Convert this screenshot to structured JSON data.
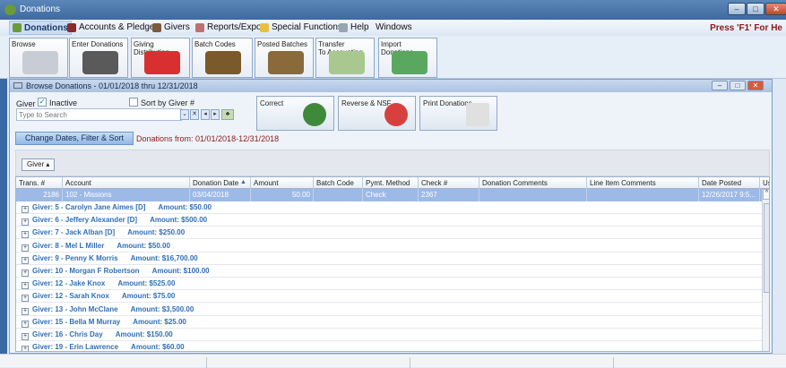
{
  "window": {
    "title": "Donations",
    "help_hint": "Press 'F1' For He"
  },
  "menu": [
    {
      "label": "Donations",
      "color": "#6a9a3a"
    },
    {
      "label": "Accounts & Pledges",
      "color": "#8b2a2a"
    },
    {
      "label": "Givers",
      "color": "#7a5a3a"
    },
    {
      "label": "Reports/Export",
      "color": "#c07070"
    },
    {
      "label": "Special Functions",
      "color": "#e8c040"
    },
    {
      "label": "Help",
      "color": "#9aa4b0"
    },
    {
      "label": "Windows",
      "color": ""
    }
  ],
  "toolbar": [
    {
      "label": "Browse",
      "color": "#c8ccd4"
    },
    {
      "label": "Enter Donations",
      "color": "#5a5a5a"
    },
    {
      "label": "Giving Distribution",
      "color": "#d83030"
    },
    {
      "label": "Batch Codes",
      "color": "#7a5a2a"
    },
    {
      "label": "Posted Batches",
      "color": "#8a6a3a"
    },
    {
      "label": "Transfer\nTo Accounting",
      "color": "#a8c890"
    },
    {
      "label": "Import Donations",
      "color": "#5aa860"
    }
  ],
  "browse": {
    "title": "Browse Donations - 01/01/2018 thru 12/31/2018",
    "giver_label": "Giver",
    "inactive_label": "Inactive",
    "inactive_checked": true,
    "sort_label": "Sort by Giver #",
    "sort_checked": false,
    "search_placeholder": "Type to Search",
    "actions": [
      {
        "label": "Correct",
        "color": "#3f8a3a"
      },
      {
        "label": "Reverse & NSF",
        "color": "#d84040"
      },
      {
        "label": "Print Donations",
        "color": "#e0e0e0"
      }
    ],
    "change_button": "Change Dates, Filter & Sort",
    "donations_from": "Donations from: 01/01/2018-12/31/2018",
    "group_chip": "Giver"
  },
  "grid": {
    "columns": [
      "Trans. #",
      "Account",
      "Donation Date",
      "Amount",
      "Batch Code",
      "Pymt. Method",
      "Check #",
      "Donation Comments",
      "Line Item Comments",
      "Date Posted",
      "Us"
    ],
    "selected_row": [
      "2186",
      "102 - Missions",
      "03/04/2018",
      "50.00",
      "",
      "Check",
      "2367",
      "",
      "",
      "12/26/2017 9:5...",
      ""
    ],
    "groups": [
      {
        "giver": "Giver: 5 - Carolyn Jane Aimes [D]",
        "amount": "Amount: $50.00"
      },
      {
        "giver": "Giver: 6 - Jeffery Alexander [D]",
        "amount": "Amount: $500.00"
      },
      {
        "giver": "Giver: 7 - Jack Alban [D]",
        "amount": "Amount: $250.00"
      },
      {
        "giver": "Giver: 8 - Mel L Miller",
        "amount": "Amount: $50.00"
      },
      {
        "giver": "Giver: 9 - Penny K Morris",
        "amount": "Amount: $16,700.00"
      },
      {
        "giver": "Giver: 10 - Morgan F Robertson",
        "amount": "Amount: $100.00"
      },
      {
        "giver": "Giver: 12 - Jake Knox",
        "amount": "Amount: $525.00"
      },
      {
        "giver": "Giver: 12 - Sarah Knox",
        "amount": "Amount: $75.00"
      },
      {
        "giver": "Giver: 13 - John McClane",
        "amount": "Amount: $3,500.00"
      },
      {
        "giver": "Giver: 15 - Bella M Murray",
        "amount": "Amount: $25.00"
      },
      {
        "giver": "Giver: 16 - Chris Day",
        "amount": "Amount: $150.00"
      },
      {
        "giver": "Giver: 19 - Erin Lawrence",
        "amount": "Amount: $60.00"
      }
    ]
  }
}
